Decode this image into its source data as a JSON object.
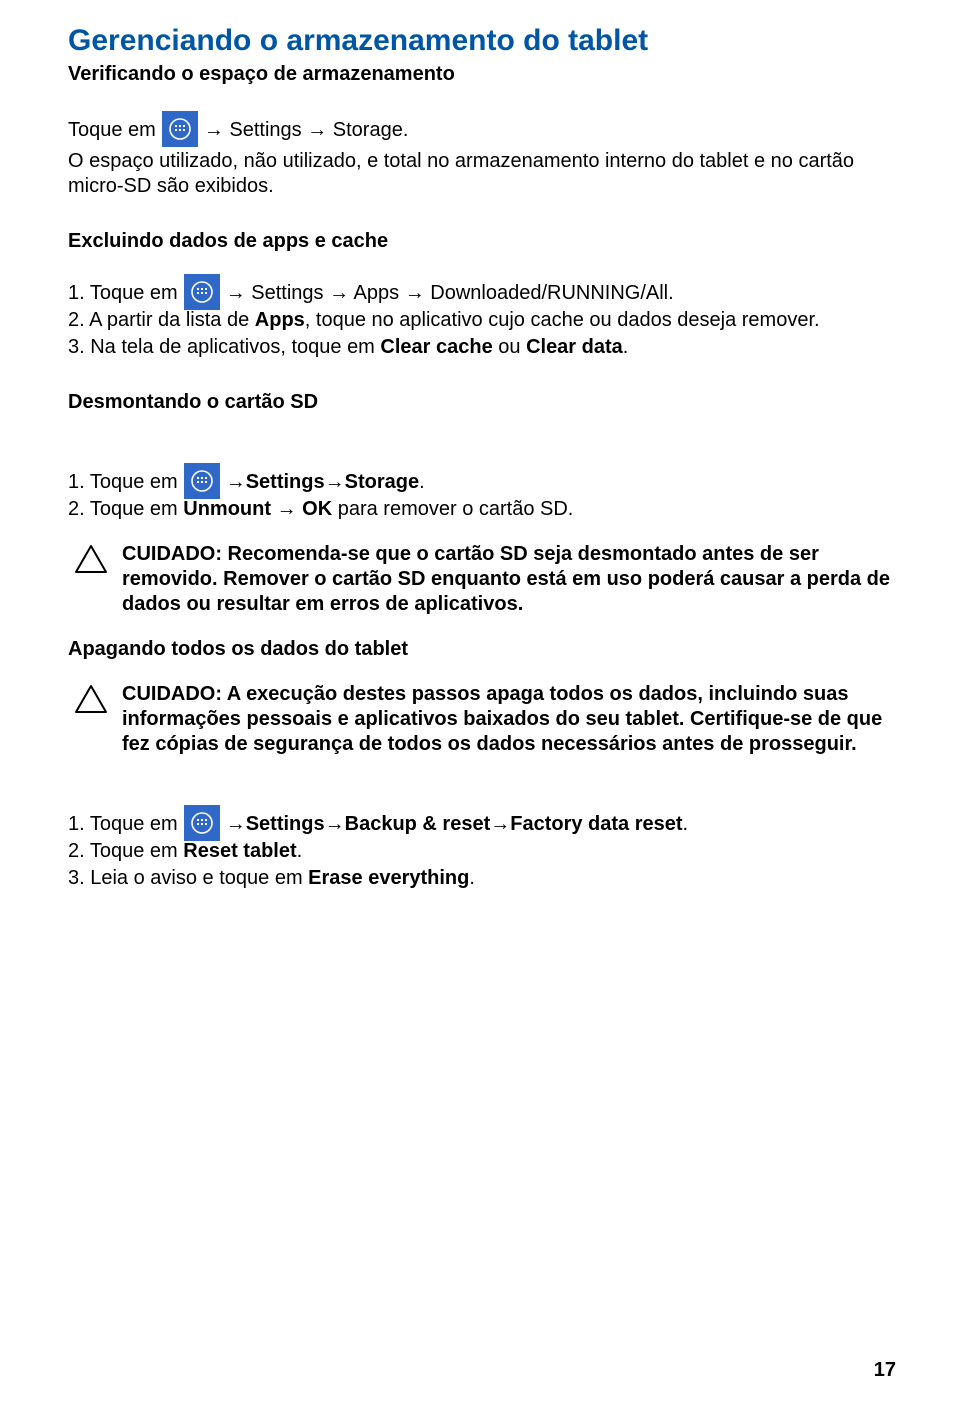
{
  "title_h1": "Gerenciando o armazenamento do tablet",
  "subtitle_h2": "Verificando o espaço de armazenamento",
  "intro_line": {
    "pre": "Toque em",
    "post": " → Settings → Storage."
  },
  "intro_para": "O espaço utilizado, não utilizado, e total no armazenamento interno do tablet e no cartão micro-SD são exibidos.",
  "sec_excluding": {
    "heading": "Excluindo dados de apps e cache",
    "step1_pre": "1. Toque em",
    "step1_post": " → Settings → Apps → Downloaded/RUNNING/All.",
    "step2_a": "2. A partir da lista de ",
    "step2_b": "Apps",
    "step2_c": ", toque no aplicativo cujo cache ou dados deseja remover.",
    "step3_a": "3. Na tela de aplicativos, toque em ",
    "step3_b": "Clear cache",
    "step3_c": " ou ",
    "step3_d": "Clear data",
    "step3_e": "."
  },
  "sec_unmount": {
    "heading": "Desmontando o cartão SD",
    "step1_pre": "1. Toque em",
    "step1_post_a": " → ",
    "step1_post_b": "Settings",
    "step1_post_c": " → ",
    "step1_post_d": "Storage",
    "step1_post_e": ".",
    "step2_a": "2. Toque em ",
    "step2_b": "Unmount",
    "step2_c": " → ",
    "step2_d": "OK",
    "step2_e": " para remover o cartão SD.",
    "caution": "CUIDADO: Recomenda-se que o cartão SD seja desmontado antes de ser removido. Remover o cartão SD enquanto está em uso poderá causar a perda de dados ou resultar em erros de aplicativos."
  },
  "sec_erase": {
    "heading": "Apagando todos os dados do tablet",
    "caution": "CUIDADO: A execução destes passos apaga todos os dados, incluindo suas informações pessoais e aplicativos baixados do seu tablet. Certifique-se de que fez cópias de segurança de todos os dados necessários antes de prosseguir.",
    "step1_pre": "1. Toque em",
    "step1_post_a": " → ",
    "step1_post_b": "Settings",
    "step1_post_c": "→ ",
    "step1_post_d": "Backup & reset",
    "step1_post_e": "→ ",
    "step1_post_f": "Factory data reset",
    "step1_post_g": ".",
    "step2_a": "2. Toque em ",
    "step2_b": "Reset tablet",
    "step2_c": ".",
    "step3_a": "3. Leia o aviso e toque em ",
    "step3_b": "Erase everything",
    "step3_c": "."
  },
  "page_number": "17"
}
